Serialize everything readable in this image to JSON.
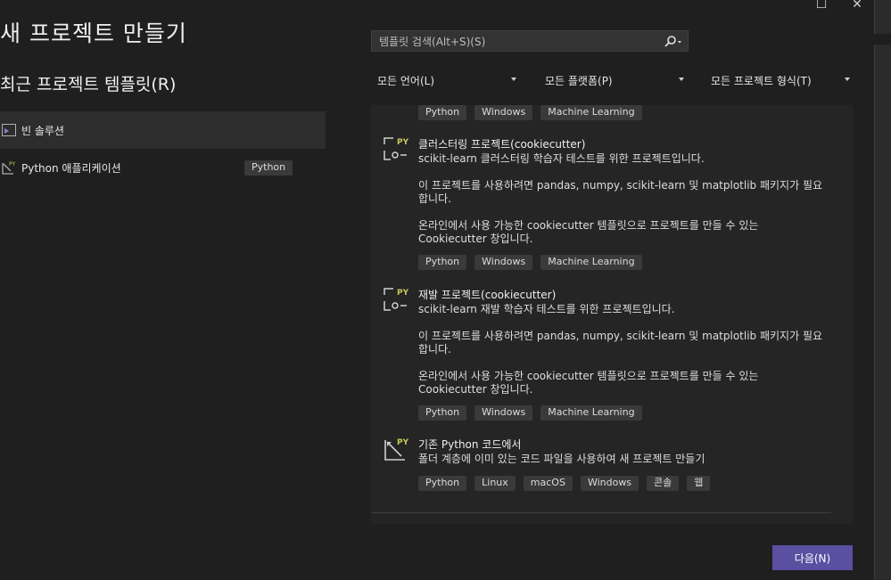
{
  "window": {
    "maximize_glyph": "☐",
    "close_glyph": "✕"
  },
  "header": {
    "title": "새 프로젝트 만들기"
  },
  "recent": {
    "heading": "최근 프로젝트 템플릿(R)",
    "items": [
      {
        "label": "빈 솔루션",
        "icon": "blank-solution-icon",
        "tag": ""
      },
      {
        "label": "Python 애플리케이션",
        "icon": "python-app-icon",
        "tag": "Python"
      }
    ]
  },
  "search": {
    "placeholder": "템플릿 검색(Alt+S)(S)",
    "value": ""
  },
  "filters": {
    "language": "모든 언어(L)",
    "platform": "모든 플랫폼(P)",
    "project_type": "모든 프로젝트 형식(T)"
  },
  "templates": {
    "top_tags": [
      "Python",
      "Windows",
      "Machine Learning"
    ],
    "items": [
      {
        "title": "클러스터링 프로젝트(cookiecutter)",
        "desc1": "scikit-learn 클러스터링 학습자 테스트를 위한 프로젝트입니다.",
        "desc2a": "이 프로젝트를 사용하려면 pandas, numpy, scikit-learn 및 matplotlib 패키지가 필요",
        "desc2b": "합니다.",
        "desc3a": "온라인에서 사용 가능한 cookiecutter 템플릿으로 프로젝트를 만들 수 있는",
        "desc3b": "Cookiecutter 창입니다.",
        "tags": [
          "Python",
          "Windows",
          "Machine Learning"
        ]
      },
      {
        "title": "재발 프로젝트(cookiecutter)",
        "desc1": "scikit-learn 재발 학습자 테스트를 위한 프로젝트입니다.",
        "desc2a": "이 프로젝트를 사용하려면 pandas, numpy, scikit-learn 및 matplotlib 패키지가 필요",
        "desc2b": "합니다.",
        "desc3a": "온라인에서 사용 가능한 cookiecutter 템플릿으로 프로젝트를 만들 수 있는",
        "desc3b": "Cookiecutter 창입니다.",
        "tags": [
          "Python",
          "Windows",
          "Machine Learning"
        ]
      },
      {
        "title": "기존 Python 코드에서",
        "desc1": "폴더 계층에 이미 있는 코드 파일을 사용하여 새 프로젝트 만들기",
        "tags": [
          "Python",
          "Linux",
          "macOS",
          "Windows",
          "콘솔",
          "웹"
        ]
      }
    ]
  },
  "footer": {
    "next_label": "다음(N)"
  },
  "colors": {
    "background": "#1f1f1f",
    "panel": "#252526",
    "tag_bg": "#3a3a3a",
    "accent_button": "#5a4fa0",
    "python_badge": "#c8c85a"
  }
}
